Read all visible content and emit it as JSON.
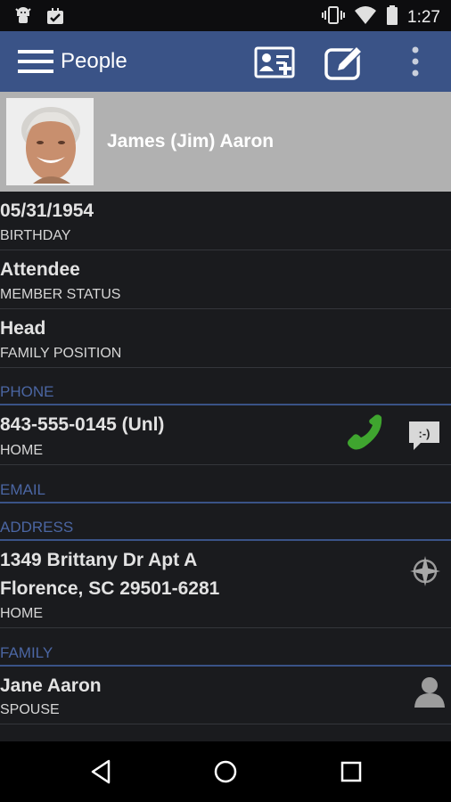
{
  "status_bar": {
    "time": "1:27",
    "icons": [
      "android-debug-icon",
      "download-done-icon",
      "vibrate-icon",
      "wifi-icon",
      "battery-icon"
    ]
  },
  "app_bar": {
    "title": "People",
    "icons": [
      "menu-icon",
      "add-contact-icon",
      "edit-icon",
      "overflow-icon"
    ]
  },
  "profile": {
    "name": "James (Jim) Aaron"
  },
  "details": [
    {
      "value": "05/31/1954",
      "label": "BIRTHDAY"
    },
    {
      "value": "Attendee",
      "label": "MEMBER STATUS"
    },
    {
      "value": "Head",
      "label": "FAMILY POSITION"
    }
  ],
  "phone": {
    "section_title": "PHONE",
    "number": "843-555-0145 (Unl)",
    "label": "HOME",
    "sms_glyph": ":-)"
  },
  "email": {
    "section_title": "EMAIL"
  },
  "address": {
    "section_title": "ADDRESS",
    "line1": "1349 Brittany Dr Apt A",
    "line2": "Florence, SC  29501-6281",
    "label": "HOME"
  },
  "family": {
    "section_title": "FAMILY",
    "members": [
      {
        "name": "Jane Aaron",
        "relation": "SPOUSE"
      }
    ]
  },
  "colors": {
    "app_bar": "#3a5387",
    "section_header": "#4b66a3",
    "call_green": "#3fa52f",
    "background": "#1a1b1e"
  }
}
